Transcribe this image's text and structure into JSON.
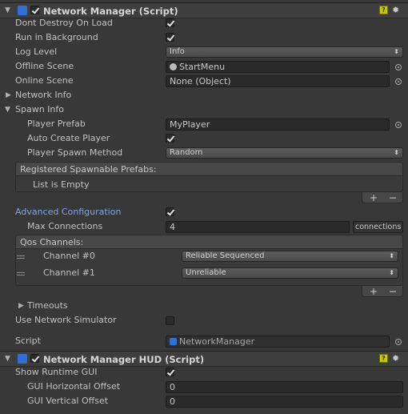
{
  "nm_component": {
    "title": "Network Manager (Script)",
    "dont_destroy_label": "Dont Destroy On Load",
    "run_in_background_label": "Run in Background",
    "log_level_label": "Log Level",
    "log_level_value": "Info",
    "offline_scene_label": "Offline Scene",
    "offline_scene_value": "StartMenu",
    "online_scene_label": "Online Scene",
    "online_scene_value": "None (Object)",
    "network_info_label": "Network Info",
    "spawn_info_label": "Spawn Info",
    "player_prefab_label": "Player Prefab",
    "player_prefab_value": "MyPlayer",
    "auto_create_label": "Auto Create Player",
    "spawn_method_label": "Player Spawn Method",
    "spawn_method_value": "Random",
    "registered_header": "Registered Spawnable Prefabs:",
    "list_empty": "List is Empty",
    "advanced_label": "Advanced Configuration",
    "max_connections_label": "Max Connections",
    "max_connections_value": "4",
    "connections_unit": "connections",
    "qos_header": "Qos Channels:",
    "channels": [
      {
        "label": "Channel #0",
        "value": "Reliable Sequenced"
      },
      {
        "label": "Channel #1",
        "value": "Unreliable"
      }
    ],
    "timeouts_label": "Timeouts",
    "use_sim_label": "Use Network Simulator",
    "script_label": "Script",
    "script_value": "NetworkManager",
    "plus": "+",
    "minus": "−",
    "dont_destroy_checked": true,
    "run_in_background_checked": true,
    "auto_create_checked": true,
    "advanced_checked": true,
    "use_sim_checked": false
  },
  "hud_component": {
    "title": "Network Manager HUD (Script)",
    "show_gui_label": "Show Runtime GUI",
    "show_gui_checked": true,
    "h_offset_label": "GUI Horizontal Offset",
    "h_offset_value": "0",
    "v_offset_label": "GUI Vertical Offset",
    "v_offset_value": "0"
  },
  "icons": {
    "component_icon_color": "#2f6fd6",
    "help_icon": "help-icon",
    "gear_icon": "gear-icon",
    "help_glyph": "?",
    "gear_glyph": "✹",
    "fold_down": "▼",
    "fold_right": "▶",
    "popup_arrows": "⬍"
  }
}
